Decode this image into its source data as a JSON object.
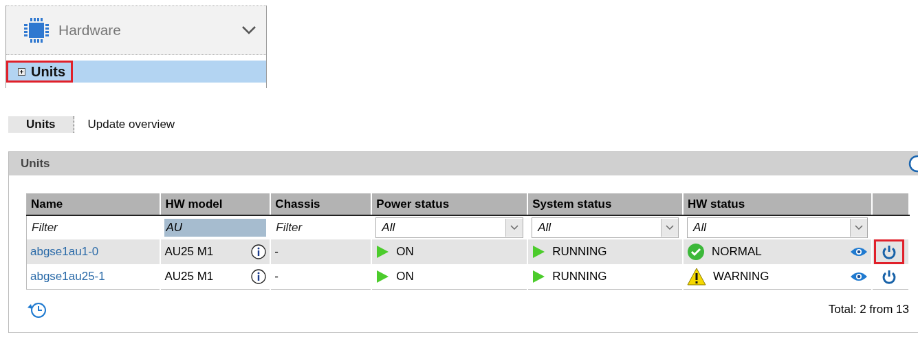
{
  "sidebar": {
    "section": {
      "title": "Hardware",
      "expanded": true
    },
    "items": [
      {
        "label": "Units",
        "selected": true,
        "expanded": false,
        "highlighted": true
      }
    ]
  },
  "tabs": [
    {
      "label": "Units",
      "selected": true
    },
    {
      "label": "Update overview",
      "selected": false
    }
  ],
  "panel": {
    "title": "Units",
    "table": {
      "columns": [
        "Name",
        "HW model",
        "Chassis",
        "Power status",
        "System status",
        "HW status"
      ],
      "filters": [
        {
          "kind": "text",
          "placeholder": "Filter"
        },
        {
          "kind": "text",
          "value": "AU",
          "focused": true
        },
        {
          "kind": "text",
          "placeholder": "Filter"
        },
        {
          "kind": "select",
          "value": "All"
        },
        {
          "kind": "select",
          "value": "All"
        },
        {
          "kind": "select",
          "value": "All"
        }
      ],
      "rows": [
        {
          "name": "abgse1au1-0",
          "model": "AU25 M1",
          "chassis": "-",
          "power": "ON",
          "system": "RUNNING",
          "hw": {
            "text": "NORMAL",
            "kind": "ok"
          },
          "selected": true,
          "power_button_highlighted": true
        },
        {
          "name": "abgse1au25-1",
          "model": "AU25 M1",
          "chassis": "-",
          "power": "ON",
          "system": "RUNNING",
          "hw": {
            "text": "WARNING",
            "kind": "warning"
          },
          "selected": false,
          "power_button_highlighted": false
        }
      ]
    },
    "total": "Total: 2 from 13"
  }
}
